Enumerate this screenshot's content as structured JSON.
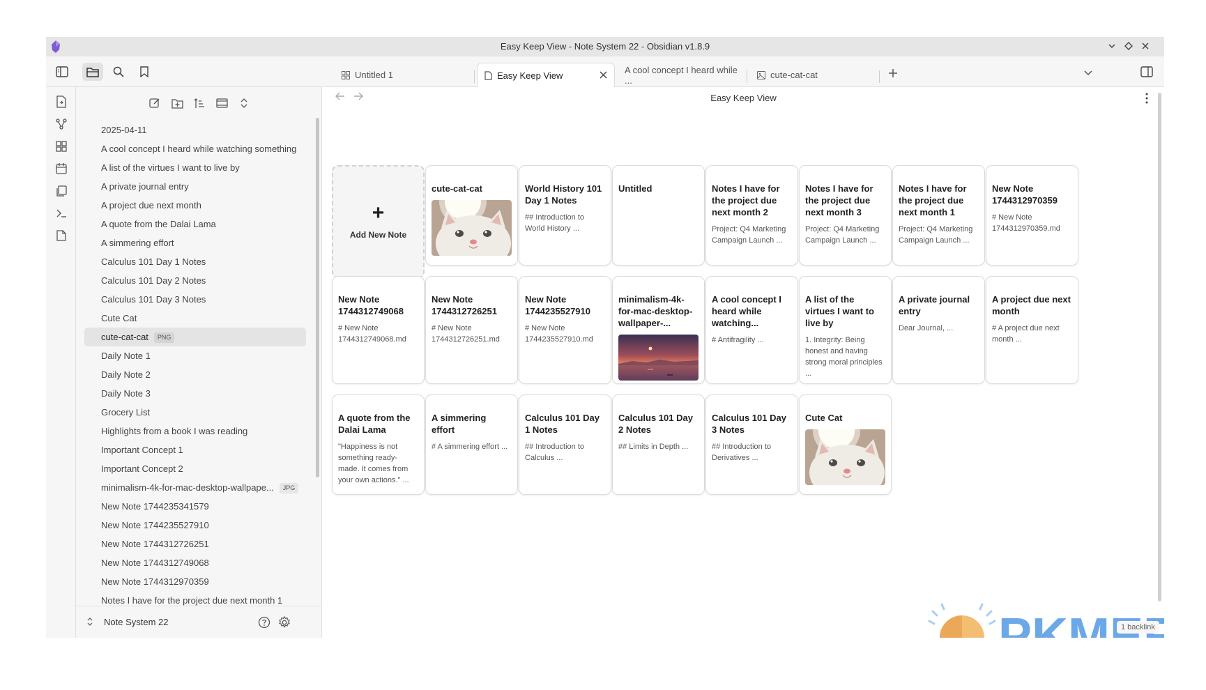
{
  "window": {
    "title": "Easy Keep View - Note System 22 - Obsidian v1.8.9"
  },
  "tabs": [
    {
      "label": "Untitled 1",
      "icon": "grid-icon",
      "active": false
    },
    {
      "label": "Easy Keep View",
      "icon": "file-icon",
      "active": true
    },
    {
      "label": "A cool concept I heard while ...",
      "icon": "none",
      "active": false
    },
    {
      "label": "cute-cat-cat",
      "icon": "image-icon",
      "active": false
    }
  ],
  "sidebar": {
    "files": [
      {
        "name": "2025-04-11",
        "badge": ""
      },
      {
        "name": "A cool concept I heard while watching something",
        "badge": ""
      },
      {
        "name": "A list of the virtues I want to live by",
        "badge": ""
      },
      {
        "name": "A private journal entry",
        "badge": ""
      },
      {
        "name": "A project due next month",
        "badge": ""
      },
      {
        "name": "A quote from the Dalai Lama",
        "badge": ""
      },
      {
        "name": "A simmering effort",
        "badge": ""
      },
      {
        "name": "Calculus 101 Day 1 Notes",
        "badge": ""
      },
      {
        "name": "Calculus 101 Day 2 Notes",
        "badge": ""
      },
      {
        "name": "Calculus 101 Day 3 Notes",
        "badge": ""
      },
      {
        "name": "Cute Cat",
        "badge": ""
      },
      {
        "name": "cute-cat-cat",
        "badge": "PNG",
        "selected": true
      },
      {
        "name": "Daily Note 1",
        "badge": ""
      },
      {
        "name": "Daily Note 2",
        "badge": ""
      },
      {
        "name": "Daily Note 3",
        "badge": ""
      },
      {
        "name": "Grocery List",
        "badge": ""
      },
      {
        "name": "Highlights from a book I was reading",
        "badge": ""
      },
      {
        "name": "Important Concept 1",
        "badge": ""
      },
      {
        "name": "Important Concept 2",
        "badge": ""
      },
      {
        "name": "minimalism-4k-for-mac-desktop-wallpape...",
        "badge": "JPG"
      },
      {
        "name": "New Note 1744235341579",
        "badge": ""
      },
      {
        "name": "New Note 1744235527910",
        "badge": ""
      },
      {
        "name": "New Note 1744312726251",
        "badge": ""
      },
      {
        "name": "New Note 1744312749068",
        "badge": ""
      },
      {
        "name": "New Note 1744312970359",
        "badge": ""
      },
      {
        "name": "Notes I have for the project due next month 1",
        "badge": ""
      }
    ],
    "vault_name": "Note System 22"
  },
  "main": {
    "view_title": "Easy Keep View",
    "add_card_label": "Add New Note",
    "add_card_symbol": "+",
    "cards": [
      {
        "title": "cute-cat-cat",
        "preview": "",
        "image": "cat"
      },
      {
        "title": "World History 101 Day 1 Notes",
        "preview": "## Introduction to World History ..."
      },
      {
        "title": "Untitled",
        "preview": ""
      },
      {
        "title": "Notes I have for the project due next month 2",
        "preview": "Project: Q4 Marketing Campaign Launch ..."
      },
      {
        "title": "Notes I have for the project due next month 3",
        "preview": "Project: Q4 Marketing Campaign Launch ..."
      },
      {
        "title": "Notes I have for the project due next month 1",
        "preview": "Project: Q4 Marketing Campaign Launch ..."
      },
      {
        "title": "New Note 1744312970359",
        "preview": "# New Note 1744312970359.md"
      },
      {
        "title": "New Note 1744312749068",
        "preview": "# New Note 1744312749068.md"
      },
      {
        "title": "New Note 1744312726251",
        "preview": "# New Note 1744312726251.md"
      },
      {
        "title": "New Note 1744235527910",
        "preview": "# New Note 1744235527910.md"
      },
      {
        "title": "minimalism-4k-for-mac-desktop-wallpaper-...",
        "preview": "",
        "image": "sunset"
      },
      {
        "title": "A cool concept I heard while watching...",
        "preview": "# Antifragility ..."
      },
      {
        "title": "A list of the virtues I want to live by",
        "preview": "1. Integrity: Being honest and having strong moral principles ..."
      },
      {
        "title": "A private journal entry",
        "preview": "Dear Journal, ..."
      },
      {
        "title": "A project due next month",
        "preview": "# A project due next month ..."
      },
      {
        "title": "A quote from the Dalai Lama",
        "preview": "\"Happiness is not something ready-made. It comes from your own actions.\" ..."
      },
      {
        "title": "A simmering effort",
        "preview": "# A simmering effort ..."
      },
      {
        "title": "Calculus 101 Day 1 Notes",
        "preview": "## Introduction to Calculus ..."
      },
      {
        "title": "Calculus 101 Day 2 Notes",
        "preview": "## Limits in Depth ..."
      },
      {
        "title": "Calculus 101 Day 3 Notes",
        "preview": "## Introduction to Derivatives ..."
      },
      {
        "title": "Cute Cat",
        "preview": "",
        "image": "cat"
      }
    ]
  },
  "status": {
    "backlinks": "1 backlink"
  },
  "watermark": {
    "text": "PKMER"
  },
  "colors": {
    "accent": "#7c5cd6",
    "selected_bg": "#e4e4e4",
    "card_border": "#dcdcdc"
  }
}
